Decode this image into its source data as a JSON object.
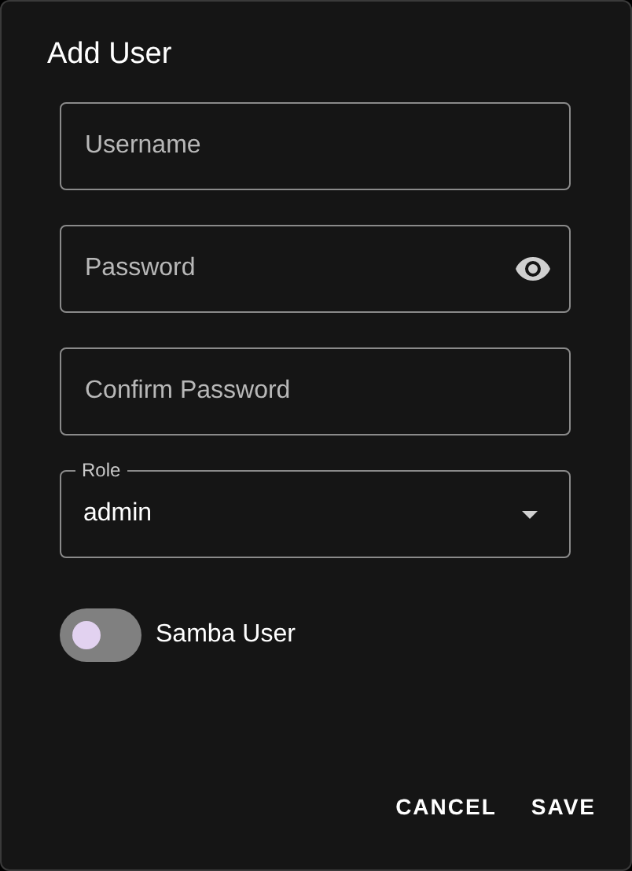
{
  "dialog": {
    "title": "Add User"
  },
  "fields": [
    {
      "kind": "text",
      "placeholder": "Username"
    },
    {
      "kind": "password",
      "placeholder": "Password"
    },
    {
      "kind": "text",
      "placeholder": "Confirm Password"
    },
    {
      "kind": "select",
      "label": "Role",
      "value": "admin"
    }
  ],
  "switch": {
    "label": "Samba User",
    "on": false
  },
  "buttons": [
    "CANCEL",
    "SAVE"
  ]
}
